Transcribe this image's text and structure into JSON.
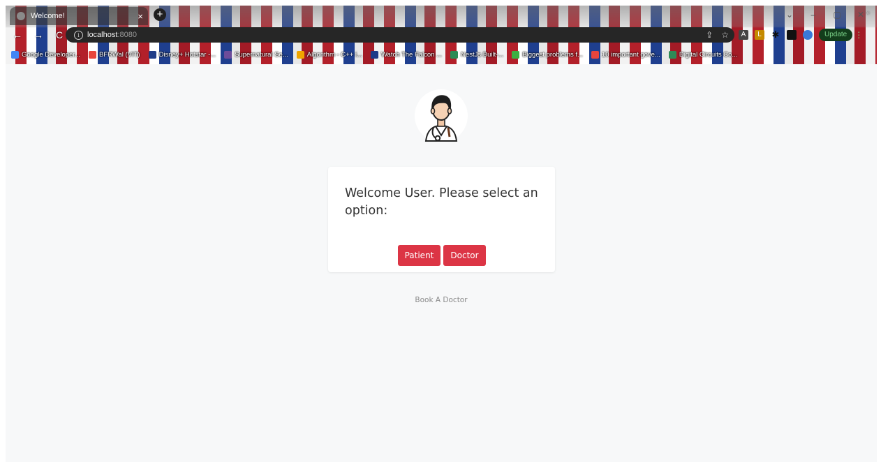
{
  "browser": {
    "tab_title": "Welcome!",
    "tab_close": "×",
    "new_tab": "+",
    "window_controls": [
      "⌄",
      "–",
      "▢",
      "✕"
    ],
    "nav": {
      "back": "←",
      "forward": "→",
      "reload": "C"
    },
    "url_host": "localhost",
    "url_port": ":8080",
    "update_label": "Update",
    "bookmarks": [
      {
        "label": "Google Developer...",
        "color": "#4285f4"
      },
      {
        "label": "BFRWal (VIT)",
        "color": "#e8453c"
      },
      {
        "label": "Disney+ Hotstar -...",
        "color": "#1f3c88"
      },
      {
        "label": "Supernatural Se...",
        "color": "#6d4c9a"
      },
      {
        "label": "Algorithm - C++ i...",
        "color": "#f0a500"
      },
      {
        "label": "Watch The Falcon ...",
        "color": "#1f3c88"
      },
      {
        "label": "NestJs Built-...",
        "color": "#2e8b57"
      },
      {
        "label": "Biggest problems f...",
        "color": "#3cb043"
      },
      {
        "label": "10 important gove...",
        "color": "#e8453c"
      },
      {
        "label": "Digital Circuits Co...",
        "color": "#2e8b57"
      }
    ],
    "bookmarks_more": "»"
  },
  "page": {
    "avatar_alt": "doctor-avatar",
    "prompt": "Welcome User. Please select an option:",
    "patient_label": "Patient",
    "doctor_label": "Doctor",
    "footer": "Book A Doctor"
  },
  "colors": {
    "primary": "#dc3545",
    "page_bg": "#f7f8f9"
  }
}
